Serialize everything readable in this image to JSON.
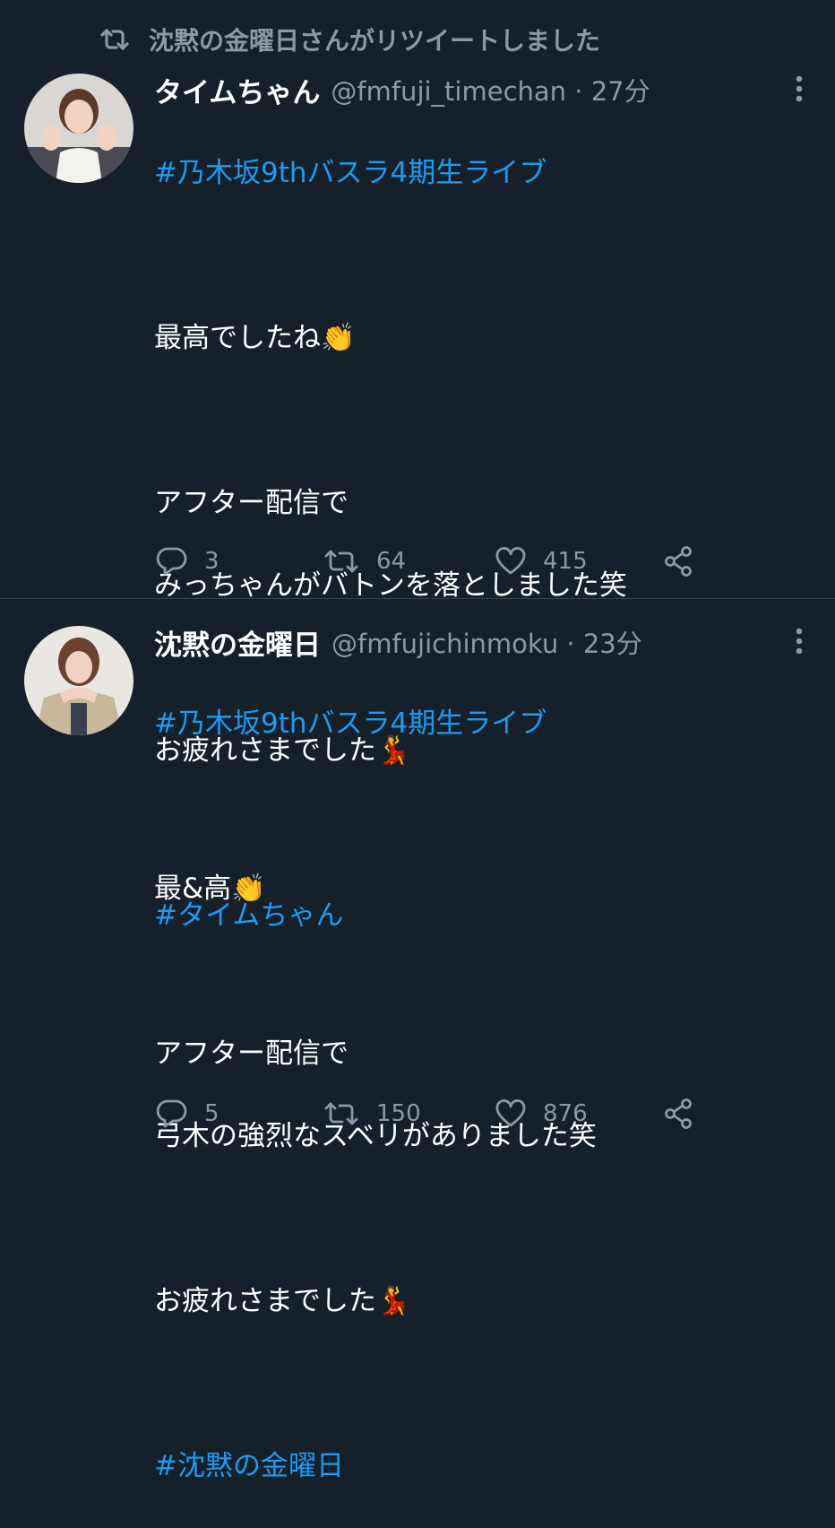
{
  "retweet_notice": "沈黙の金曜日さんがリツイートしました",
  "tweets": [
    {
      "display_name": "タイムちゃん",
      "handle_time": "@fmfuji_timechan · 27分",
      "lines": [
        {
          "text": "#乃木坂9thバスラ4期生ライブ",
          "hashtag": true
        },
        {
          "text": "",
          "hashtag": false
        },
        {
          "text": "最高でしたね👏",
          "hashtag": false
        },
        {
          "text": "",
          "hashtag": false
        },
        {
          "text": "アフター配信で",
          "hashtag": false
        },
        {
          "text": "みっちゃんがバトンを落としました笑",
          "hashtag": false
        },
        {
          "text": "",
          "hashtag": false
        },
        {
          "text": "お疲れさまでした💃",
          "hashtag": false
        },
        {
          "text": "",
          "hashtag": false
        },
        {
          "text": "#タイムちゃん",
          "hashtag": true
        }
      ],
      "replies": "3",
      "retweets": "64",
      "likes": "415"
    },
    {
      "display_name": "沈黙の金曜日",
      "handle_time": "@fmfujichinmoku · 23分",
      "lines": [
        {
          "text": "#乃木坂9thバスラ4期生ライブ",
          "hashtag": true
        },
        {
          "text": "",
          "hashtag": false
        },
        {
          "text": "最&高👏",
          "hashtag": false
        },
        {
          "text": "",
          "hashtag": false
        },
        {
          "text": "アフター配信で",
          "hashtag": false
        },
        {
          "text": "弓木の強烈なスベリがありました笑",
          "hashtag": false
        },
        {
          "text": "",
          "hashtag": false
        },
        {
          "text": "お疲れさまでした💃",
          "hashtag": false
        },
        {
          "text": "",
          "hashtag": false
        },
        {
          "text": "#沈黙の金曜日",
          "hashtag": true
        }
      ],
      "replies": "5",
      "retweets": "150",
      "likes": "876"
    }
  ],
  "icons": {
    "retweet": "retweet-icon",
    "reply": "reply-icon",
    "like": "heart-icon",
    "share": "share-icon",
    "more": "more-vertical-icon"
  },
  "colors": {
    "background": "#15202b",
    "hashtag": "#1d9bf0",
    "secondary_text": "#8b98a5",
    "divider": "#38444d"
  }
}
